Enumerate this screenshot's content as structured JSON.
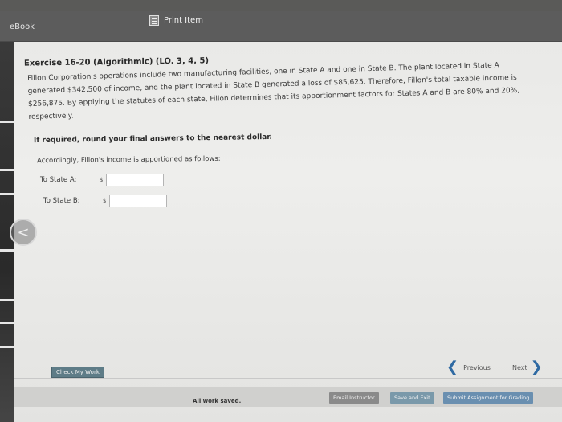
{
  "header": {
    "tab_label": "eBook",
    "print_label": "Print Item"
  },
  "exercise": {
    "title": "Exercise 16-20 (Algorithmic) (LO. 3, 4, 5)",
    "lines": [
      "Fillon Corporation's operations include two manufacturing facilities, one in State A and one in State B. The plant located in State A",
      "generated $342,500 of income, and the plant located in State B generated a loss of $85,625. Therefore, Fillon's total taxable income is",
      "$256,875. By applying the statutes of each state, Fillon determines that its apportionment factors for States A and B are 80% and 20%,",
      "respectively."
    ],
    "instruction": "If required, round your final answers to the nearest dollar.",
    "intro": "Accordingly, Fillon's income is apportioned as follows:"
  },
  "answers": {
    "state_a_label": "To State A:",
    "state_b_label": "To State B:",
    "currency": "$",
    "state_a_value": "",
    "state_b_value": ""
  },
  "navigation": {
    "back_symbol": "<",
    "check_work_label": "Check My Work",
    "previous_label": "Previous",
    "next_label": "Next"
  },
  "footer": {
    "saved_status": "All work saved.",
    "email_label": "Email Instructor",
    "save_exit_label": "Save and Exit",
    "submit_label": "Submit Assignment for Grading"
  }
}
